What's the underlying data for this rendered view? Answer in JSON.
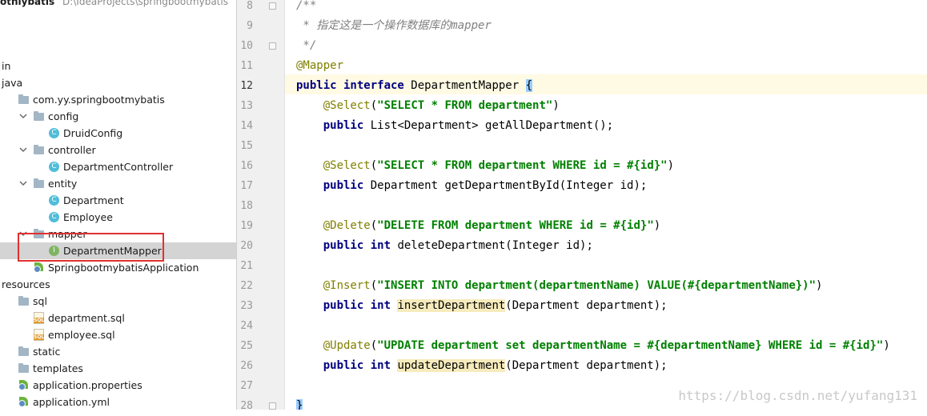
{
  "header": {
    "project_name": "othlybatis",
    "project_path": "D:\\IdeaProjects\\springbootmybatis"
  },
  "tree": [
    {
      "label": "in",
      "indent": 0,
      "icon": "none",
      "arrow": "none"
    },
    {
      "label": "java",
      "indent": 0,
      "icon": "none",
      "arrow": "none"
    },
    {
      "label": "com.yy.springbootmybatis",
      "indent": 1,
      "icon": "folder",
      "arrow": "none"
    },
    {
      "label": "config",
      "indent": 2,
      "icon": "folder",
      "arrow": "expanded"
    },
    {
      "label": "DruidConfig",
      "indent": 3,
      "icon": "class",
      "arrow": "none"
    },
    {
      "label": "controller",
      "indent": 2,
      "icon": "folder",
      "arrow": "expanded"
    },
    {
      "label": "DepartmentController",
      "indent": 3,
      "icon": "class",
      "arrow": "none"
    },
    {
      "label": "entity",
      "indent": 2,
      "icon": "folder",
      "arrow": "expanded"
    },
    {
      "label": "Department",
      "indent": 3,
      "icon": "class",
      "arrow": "none"
    },
    {
      "label": "Employee",
      "indent": 3,
      "icon": "class",
      "arrow": "none"
    },
    {
      "label": "mapper",
      "indent": 2,
      "icon": "folder",
      "arrow": "expanded"
    },
    {
      "label": "DepartmentMapper",
      "indent": 3,
      "icon": "interface",
      "arrow": "none",
      "selected": true
    },
    {
      "label": "SpringbootmybatisApplication",
      "indent": 2,
      "icon": "spring",
      "arrow": "none"
    },
    {
      "label": "resources",
      "indent": 0,
      "icon": "none",
      "arrow": "none"
    },
    {
      "label": "sql",
      "indent": 1,
      "icon": "folder",
      "arrow": "none"
    },
    {
      "label": "department.sql",
      "indent": 2,
      "icon": "sql",
      "arrow": "none"
    },
    {
      "label": "employee.sql",
      "indent": 2,
      "icon": "sql",
      "arrow": "none"
    },
    {
      "label": "static",
      "indent": 1,
      "icon": "folder",
      "arrow": "none"
    },
    {
      "label": "templates",
      "indent": 1,
      "icon": "folder",
      "arrow": "none"
    },
    {
      "label": "application.properties",
      "indent": 1,
      "icon": "spring",
      "arrow": "none"
    },
    {
      "label": "application.yml",
      "indent": 1,
      "icon": "spring",
      "arrow": "none"
    }
  ],
  "editor": {
    "current_line": 12,
    "lines": [
      {
        "n": 8,
        "tokens": [
          [
            "cm",
            "/**"
          ]
        ]
      },
      {
        "n": 9,
        "tokens": [
          [
            "cm",
            " * 指定这是一个操作数据库的mapper"
          ]
        ]
      },
      {
        "n": 10,
        "tokens": [
          [
            "cm",
            " */"
          ]
        ]
      },
      {
        "n": 11,
        "tokens": [
          [
            "ann",
            "@Mapper"
          ]
        ]
      },
      {
        "n": 12,
        "tokens": [
          [
            "kw",
            "public interface "
          ],
          [
            "",
            "DepartmentMapper "
          ],
          [
            "brace",
            "{"
          ]
        ]
      },
      {
        "n": 13,
        "tokens": [
          [
            "",
            "    "
          ],
          [
            "ann",
            "@Select"
          ],
          [
            "",
            "("
          ],
          [
            "str",
            "\"SELECT * FROM department\""
          ],
          [
            "",
            ")"
          ]
        ]
      },
      {
        "n": 14,
        "tokens": [
          [
            "",
            "    "
          ],
          [
            "kw",
            "public "
          ],
          [
            "",
            "List<Department> getAllDepartment();"
          ]
        ]
      },
      {
        "n": 15,
        "tokens": []
      },
      {
        "n": 16,
        "tokens": [
          [
            "",
            "    "
          ],
          [
            "ann",
            "@Select"
          ],
          [
            "",
            "("
          ],
          [
            "str",
            "\"SELECT * FROM department WHERE id = #{id}\""
          ],
          [
            "",
            ")"
          ]
        ]
      },
      {
        "n": 17,
        "tokens": [
          [
            "",
            "    "
          ],
          [
            "kw",
            "public "
          ],
          [
            "",
            "Department getDepartmentById(Integer id);"
          ]
        ]
      },
      {
        "n": 18,
        "tokens": []
      },
      {
        "n": 19,
        "tokens": [
          [
            "",
            "    "
          ],
          [
            "ann",
            "@Delete"
          ],
          [
            "",
            "("
          ],
          [
            "str",
            "\"DELETE FROM department WHERE id = #{id}\""
          ],
          [
            "",
            ")"
          ]
        ]
      },
      {
        "n": 20,
        "tokens": [
          [
            "",
            "    "
          ],
          [
            "kw",
            "public int "
          ],
          [
            "",
            "deleteDepartment(Integer id);"
          ]
        ]
      },
      {
        "n": 21,
        "tokens": []
      },
      {
        "n": 22,
        "tokens": [
          [
            "",
            "    "
          ],
          [
            "ann",
            "@Insert"
          ],
          [
            "",
            "("
          ],
          [
            "str",
            "\"INSERT INTO department(departmentName) VALUE(#{departmentName})\""
          ],
          [
            "",
            ")"
          ]
        ]
      },
      {
        "n": 23,
        "tokens": [
          [
            "",
            "    "
          ],
          [
            "kw",
            "public int "
          ],
          [
            "hl",
            "insertDepartment"
          ],
          [
            "",
            "(Department department);"
          ]
        ]
      },
      {
        "n": 24,
        "tokens": []
      },
      {
        "n": 25,
        "tokens": [
          [
            "",
            "    "
          ],
          [
            "ann",
            "@Update"
          ],
          [
            "",
            "("
          ],
          [
            "str",
            "\"UPDATE department set departmentName = #{departmentName} WHERE id = #{id}\""
          ],
          [
            "",
            ")"
          ]
        ]
      },
      {
        "n": 26,
        "tokens": [
          [
            "",
            "    "
          ],
          [
            "kw",
            "public int "
          ],
          [
            "hl",
            "updateDepartment"
          ],
          [
            "",
            "(Department department);"
          ]
        ]
      },
      {
        "n": 27,
        "tokens": []
      },
      {
        "n": 28,
        "tokens": [
          [
            "brace",
            "}"
          ]
        ]
      }
    ]
  },
  "watermark": "https://blog.csdn.net/yufang131",
  "colors": {
    "selection": "#d4d4d4",
    "current_line": "#fffae3",
    "keyword": "#000080",
    "string": "#008000",
    "annotation": "#808000",
    "comment": "#808080",
    "red_box": "#e0312e"
  }
}
